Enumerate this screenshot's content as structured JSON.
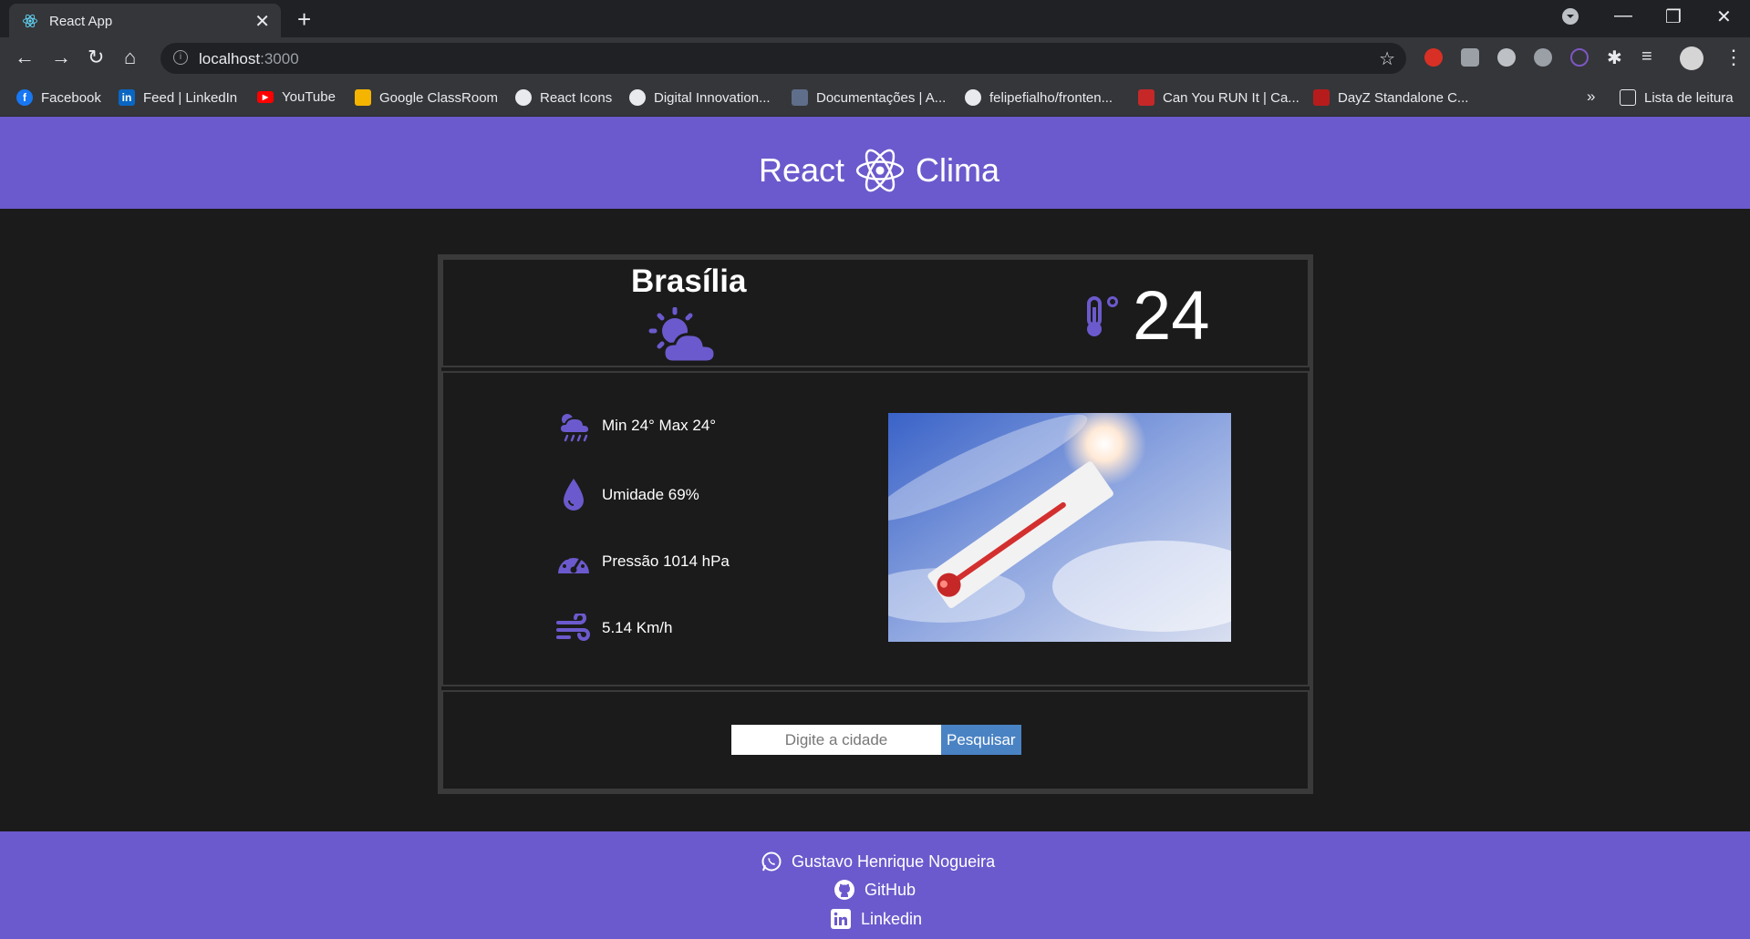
{
  "browser": {
    "tab_title": "React App",
    "url_host": "localhost",
    "url_port": ":3000",
    "bookmarks": [
      {
        "label": "Facebook",
        "icon": "facebook-icon"
      },
      {
        "label": "Feed | LinkedIn",
        "icon": "linkedin-icon"
      },
      {
        "label": "YouTube",
        "icon": "youtube-icon"
      },
      {
        "label": "Google ClassRoom",
        "icon": "classroom-icon"
      },
      {
        "label": "React Icons",
        "icon": "globe-icon"
      },
      {
        "label": "Digital Innovation...",
        "icon": "globe-icon"
      },
      {
        "label": "Documentações | A...",
        "icon": "docs-icon"
      },
      {
        "label": "felipefialho/fronten...",
        "icon": "github-icon"
      },
      {
        "label": "Can You RUN It | Ca...",
        "icon": "canyourunit-icon"
      },
      {
        "label": "DayZ Standalone C...",
        "icon": "dayz-icon"
      }
    ],
    "overflow": "»",
    "reading_list": "Lista de leitura"
  },
  "app": {
    "brand_left": "React",
    "brand_right": "Clima",
    "city": "Brasília",
    "temperature": "24",
    "min_max": "Min 24° Max 24°",
    "humidity": "Umidade 69%",
    "pressure": "Pressão 1014 hPa",
    "wind": "5.14 Km/h",
    "search_placeholder": "Digite a cidade",
    "search_button": "Pesquisar"
  },
  "footer": {
    "author": "Gustavo Henrique Nogueira",
    "github": "GitHub",
    "linkedin": "Linkedin"
  },
  "colors": {
    "accent": "#6b5acd",
    "button": "#4a83c4",
    "background": "#1b1b1b"
  }
}
